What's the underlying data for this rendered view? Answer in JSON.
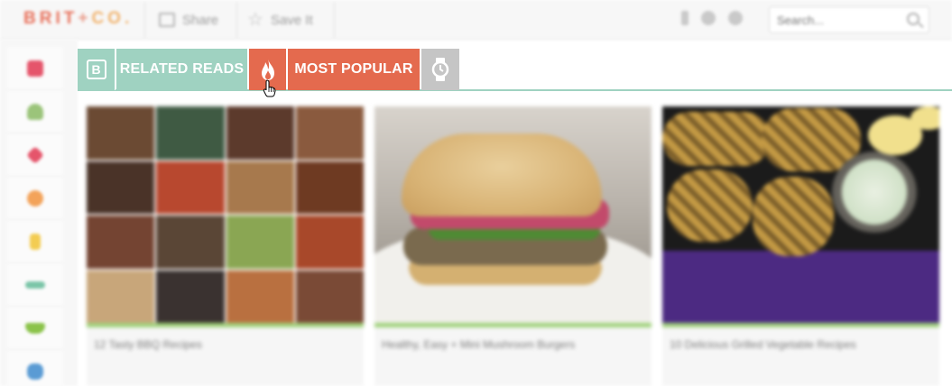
{
  "header": {
    "logo_main": "BRIT",
    "logo_plus": "+",
    "logo_co": "CO.",
    "share_label": "Share",
    "save_label": "Save It",
    "search_placeholder": "Search..."
  },
  "colors": {
    "related_reads": "#9fd2c1",
    "most_popular": "#e46a4e",
    "inactive_tab": "#c5c5c5",
    "brand": "#e8705a",
    "card_accent": "#9fd27a"
  },
  "rail": {
    "items": [
      {
        "icon": "gift-icon",
        "color": "#e5556b"
      },
      {
        "icon": "leaf-icon",
        "color": "#9bc47a"
      },
      {
        "icon": "scissors-icon",
        "color": "#e5556b"
      },
      {
        "icon": "cupcake-icon",
        "color": "#f3a35a"
      },
      {
        "icon": "trophy-icon",
        "color": "#f3cc52"
      },
      {
        "icon": "mustache-icon",
        "color": "#7bc5a8"
      },
      {
        "icon": "bowl-icon",
        "color": "#8bc34a"
      },
      {
        "icon": "owl-icon",
        "color": "#5a9bd4"
      }
    ]
  },
  "tabs": {
    "brand_letter": "B",
    "related_label": "RELATED READS",
    "popular_label": "MOST POPULAR"
  },
  "cards": [
    {
      "title": "12 Tasty BBQ Recipes"
    },
    {
      "title": "Healthy, Easy + Mini Mushroom Burgers"
    },
    {
      "title": "10 Delicious Grilled Vegetable Recipes"
    }
  ]
}
